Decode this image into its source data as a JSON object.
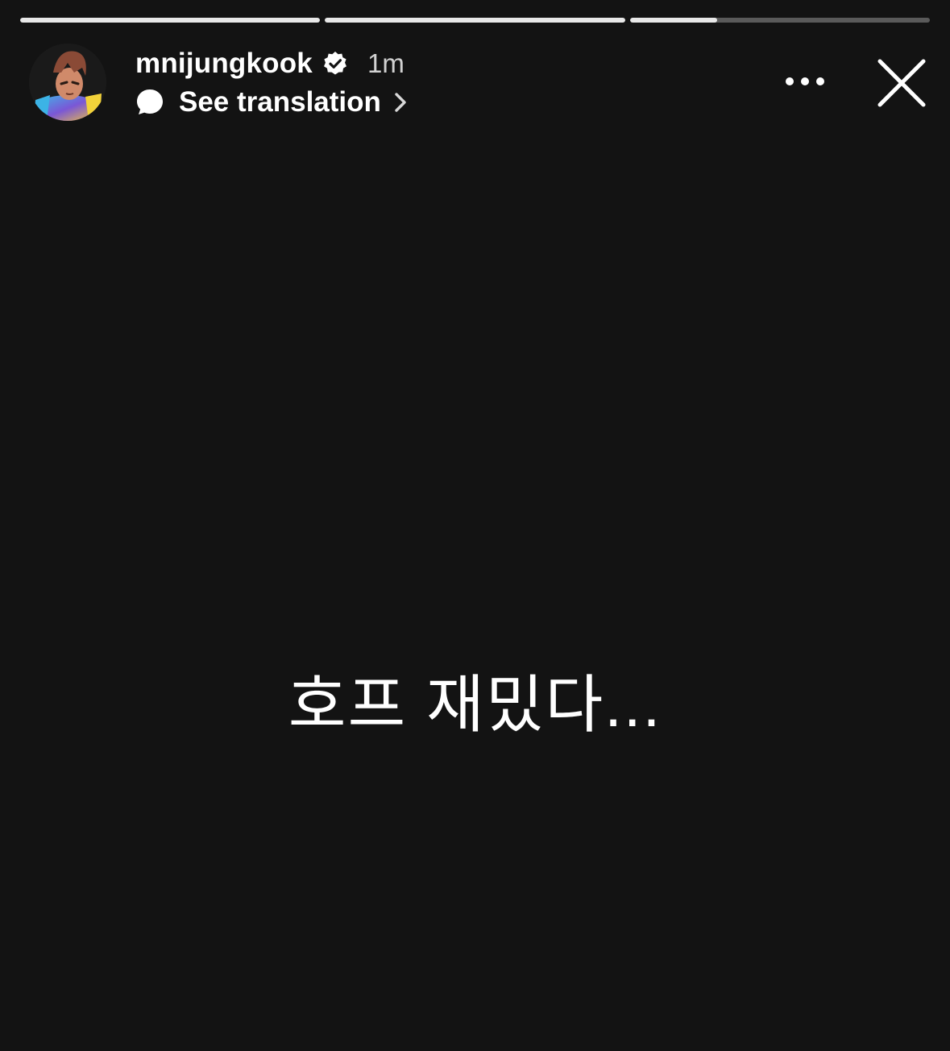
{
  "progress": [
    {
      "state": "completed",
      "fill_fraction": 1.0
    },
    {
      "state": "completed",
      "fill_fraction": 1.0
    },
    {
      "state": "current",
      "fill_fraction": 0.29
    }
  ],
  "header": {
    "username": "mnijungkook",
    "verified": true,
    "time_ago": "1m",
    "translation_label": "See translation"
  },
  "actions": {
    "more_icon": "more-horizontal-icon",
    "close_icon": "close-icon"
  },
  "story": {
    "text": "호프 재밌다..."
  },
  "colors": {
    "background": "#131313",
    "progress_track": "#5a5a5a",
    "progress_fill": "#e8e8e8",
    "text": "#ffffff"
  }
}
